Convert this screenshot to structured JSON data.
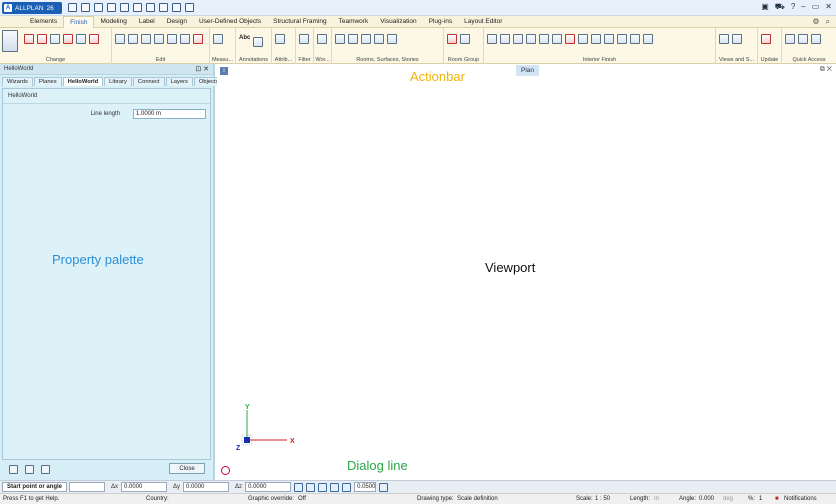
{
  "app": {
    "logo": "A",
    "name": "ALLPLAN",
    "version": "26"
  },
  "ribbon_tabs": [
    "Elements",
    "Finish",
    "Modeling",
    "Label",
    "Design",
    "User-Defined Objects",
    "Structural Framing",
    "Teamwork",
    "Visualization",
    "Plug-ins",
    "Layout Editor"
  ],
  "active_tab": "Finish",
  "ribbon_groups": [
    {
      "label": "Change"
    },
    {
      "label": "Edit"
    },
    {
      "label": "Measu..."
    },
    {
      "label": "Annotations"
    },
    {
      "label": "Attrib..."
    },
    {
      "label": "Filter"
    },
    {
      "label": "Wor..."
    },
    {
      "label": "Rooms, Surfaces, Stories"
    },
    {
      "label": "Room Group"
    },
    {
      "label": "Interior Finish"
    },
    {
      "label": "Views and S..."
    },
    {
      "label": "Update"
    },
    {
      "label": "Quick Access"
    }
  ],
  "annotations_icon_text": "Abc",
  "palette": {
    "title": "HelloWorld",
    "tabs": [
      "Wizards",
      "Planes",
      "HelloWorld",
      "Library",
      "Connect",
      "Layers",
      "Objects"
    ],
    "active_tab": "HelloWorld",
    "section": "HelloWorld",
    "line_length_label": "Line length",
    "line_length_value": "1.0000 m",
    "close_label": "Close",
    "overlay_label": "Property palette"
  },
  "viewport": {
    "plan_tab": "Plan",
    "actionbar_label": "Actionbar",
    "viewport_label": "Viewport",
    "dialog_label": "Dialog line",
    "axis_x": "X",
    "axis_y": "Y",
    "axis_z": "Z"
  },
  "dialog_line": {
    "prompt": "Start point or angle",
    "dx_label": "Δx",
    "dx_value": "0.0000",
    "dy_label": "Δy",
    "dy_value": "0.0000",
    "dz_label": "Δz",
    "dz_value": "0.0000",
    "step_value": "0.0500"
  },
  "status_bar": {
    "help": "Press F1 to get Help.",
    "country_label": "Country:",
    "graphic_override_label": "Graphic override:",
    "graphic_override_value": "Off",
    "drawing_type_label": "Drawing type:",
    "drawing_type_value": "Scale definition",
    "scale_label": "Scale:",
    "scale_value": "1 : 50",
    "length_label": "Length:",
    "length_unit": "m",
    "angle_label": "Angle:",
    "angle_value": "0.000",
    "angle_unit": "deg",
    "percent_label": "%:",
    "percent_value": "1",
    "notifications": "Notifications"
  }
}
